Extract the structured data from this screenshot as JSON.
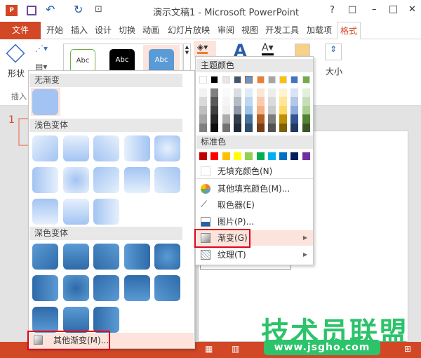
{
  "title": "演示文稿1 - Microsoft PowerPoint",
  "window_controls": [
    "?",
    "□",
    "–",
    "□",
    "✕"
  ],
  "tabs": [
    "文件",
    "开始",
    "插入",
    "设计",
    "切换",
    "动画",
    "幻灯片放映",
    "审阅",
    "视图",
    "开发工具",
    "加载项",
    "格式"
  ],
  "active_tab": "格式",
  "ribbon": {
    "shape_label": "形状",
    "insert_label": "插入",
    "style_samples": [
      "Abc",
      "Abc",
      "Abc"
    ],
    "size_label": "大小"
  },
  "slide_number": "1",
  "gallery": {
    "no_gradient": "无渐变",
    "light_variations": "浅色变体",
    "dark_variations": "深色变体",
    "more_gradients": "其他渐变(M)..."
  },
  "color_menu": {
    "theme_colors_label": "主题颜色",
    "theme_colors": [
      "#ffffff",
      "#000000",
      "#e7e6e6",
      "#44546a",
      "#5b9bd5",
      "#ed7d31",
      "#a5a5a5",
      "#ffc000",
      "#4472c4",
      "#70ad47"
    ],
    "standard_colors_label": "标准色",
    "standard_colors": [
      "#c00000",
      "#ff0000",
      "#ffc000",
      "#ffff00",
      "#92d050",
      "#00b050",
      "#00b0f0",
      "#0070c0",
      "#002060",
      "#7030a0"
    ],
    "no_fill": "无填充颜色(N)",
    "more_fill": "其他填充颜色(M)...",
    "eyedropper": "取色器(E)",
    "picture": "图片(P)...",
    "gradient": "渐变(G)",
    "texture": "纹理(T)"
  },
  "watermark": {
    "text": "技术员联盟",
    "url": "www.jsgho.com"
  },
  "colors": {
    "accent": "#d24726",
    "highlight": "#fce4dc",
    "selection_border": "#e0001b"
  }
}
